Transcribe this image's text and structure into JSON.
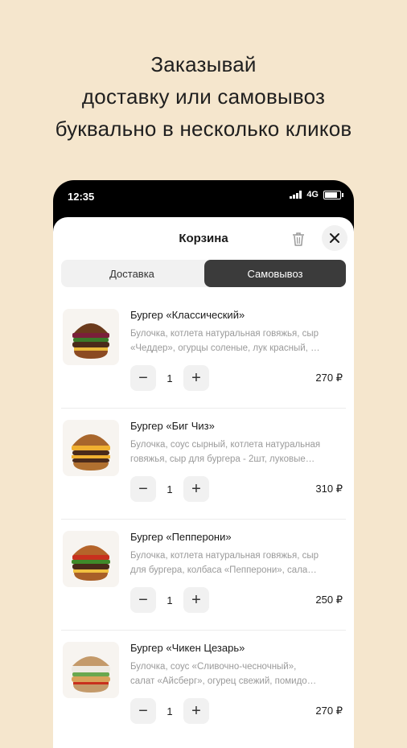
{
  "headline": {
    "line1": "Заказывай",
    "line2": "доставку или самовывоз",
    "line3": "буквально в несколько кликов"
  },
  "status_bar": {
    "time": "12:35",
    "network": "4G",
    "icons": [
      "signal-icon",
      "battery-icon"
    ]
  },
  "cart": {
    "title": "Корзина",
    "icons": [
      "trash-icon",
      "close-icon"
    ],
    "tabs": [
      {
        "label": "Доставка",
        "selected": false
      },
      {
        "label": "Самовывоз",
        "selected": true
      }
    ],
    "items": [
      {
        "name": "Бургер «Классический»",
        "desc_line1": "Булочка, котлета натуральная говяжья, сыр",
        "desc_line2": "«Чеддер», огурцы соленые, лук красный, …",
        "qty": "1",
        "price": "270 ₽",
        "minus": "−",
        "plus": "+"
      },
      {
        "name": "Бургер «Биг Чиз»",
        "desc_line1": "Булочка, соус сырный, котлета натуральная",
        "desc_line2": "говяжья, сыр для бургера - 2шт, луковые…",
        "qty": "1",
        "price": "310 ₽",
        "minus": "−",
        "plus": "+"
      },
      {
        "name": "Бургер «Пепперони»",
        "desc_line1": "Булочка, котлета натуральная говяжья, сыр",
        "desc_line2": "для бургера, колбаса «Пепперони», сала…",
        "qty": "1",
        "price": "250 ₽",
        "minus": "−",
        "plus": "+"
      },
      {
        "name": "Бургер «Чикен Цезарь»",
        "desc_line1": "Булочка, соус «Сливочно-чесночный»,",
        "desc_line2": "салат «Айсберг», огурец свежий, помидо…",
        "qty": "1",
        "price": "270 ₽",
        "minus": "−",
        "plus": "+"
      }
    ]
  },
  "colors": {
    "background": "#f5e6cd",
    "selected_tab": "#3b3b3b",
    "control_bg": "#f1f1f1"
  }
}
